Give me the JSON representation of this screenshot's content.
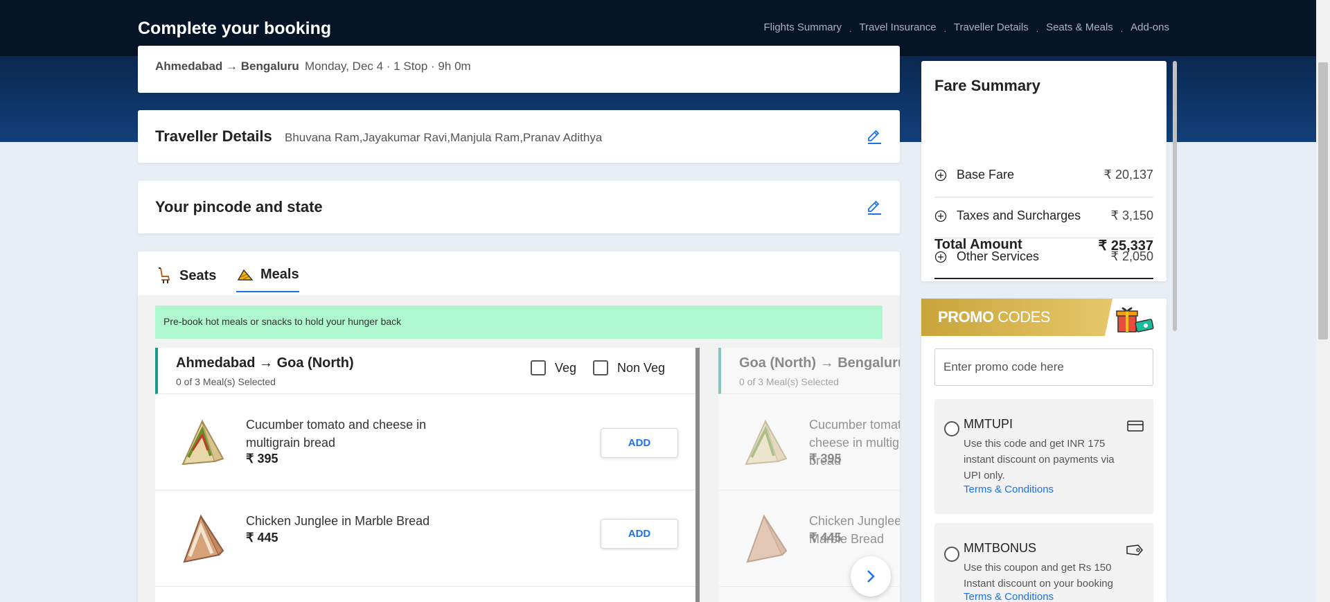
{
  "header": {
    "title": "Complete your booking",
    "nav": [
      "Flights Summary",
      "Travel Insurance",
      "Traveller Details",
      "Seats & Meals",
      "Add-ons"
    ]
  },
  "route": {
    "from_to": "Ahmedabad → Bengaluru",
    "meta": "Monday, Dec 4 · 1 Stop · 9h 0m"
  },
  "traveller": {
    "title": "Traveller Details",
    "names": "Bhuvana Ram,Jayakumar Ravi,Manjula Ram,Pranav Adithya"
  },
  "pincode": {
    "title": "Your pincode and state"
  },
  "tabs": {
    "seats": "Seats",
    "meals": "Meals"
  },
  "meals": {
    "banner": "Pre-book hot meals or snacks to hold your hunger back",
    "segments": [
      {
        "route": "Ahmedabad → Goa (North)",
        "count": "0 of 3 Meal(s) Selected",
        "filters": {
          "veg": "Veg",
          "nonveg": "Non Veg"
        },
        "items": [
          {
            "name": "Cucumber tomato and cheese in multigrain bread",
            "price": "₹ 395",
            "button": "ADD"
          },
          {
            "name": "Chicken Junglee in Marble Bread",
            "price": "₹ 445",
            "button": "ADD"
          }
        ]
      },
      {
        "route": "Goa (North) → Bengaluru",
        "count": "0 of 3 Meal(s) Selected",
        "items": [
          {
            "name": "Cucumber tomato and cheese in multigrain bread",
            "price": "₹ 395"
          },
          {
            "name": "Chicken Junglee in Marble Bread",
            "price": "₹ 445"
          }
        ]
      }
    ]
  },
  "fare": {
    "title": "Fare Summary",
    "rows": [
      {
        "label": "Base Fare",
        "amount": "₹ 20,137"
      },
      {
        "label": "Taxes and Surcharges",
        "amount": "₹ 3,150"
      },
      {
        "label": "Other Services",
        "amount": "₹ 2,050"
      }
    ],
    "total_label": "Total Amount",
    "total_amount": "₹ 25,337"
  },
  "promo": {
    "title_bold": "PROMO",
    "title_light": " CODES",
    "placeholder": "Enter promo code here",
    "codes": [
      {
        "code": "MMTUPI",
        "desc": "Use this code and get INR 175 instant discount on payments via UPI only.",
        "tc": "Terms & Conditions",
        "icon": "card-icon"
      },
      {
        "code": "MMTBONUS",
        "desc": "Use this coupon and get Rs 150 Instant discount on your booking",
        "tc": "Terms & Conditions",
        "icon": "tag-icon"
      }
    ]
  },
  "colors": {
    "accent": "#1a73e8",
    "header_bg": "#051426",
    "banner_bg": "#aef7cf",
    "promo_gold": "#c9a43a"
  }
}
